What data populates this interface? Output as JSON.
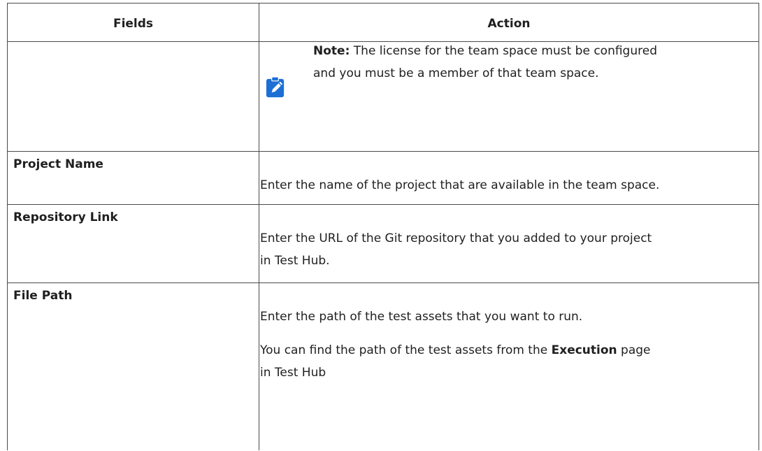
{
  "table": {
    "header": {
      "fields": "Fields",
      "action": "Action"
    },
    "note": {
      "icon": "pencil-note-icon",
      "label": "Note:",
      "text_line1": " The license for the team space must be configured",
      "text_line2": "and you must be a member of that team space."
    },
    "rows": [
      {
        "field": "Project Name",
        "action": "Enter the name of the project that are available in the team space."
      },
      {
        "field": "Repository Link",
        "action_line1": "Enter the URL of the Git repository that you added to your project",
        "action_line2": "in Test Hub."
      },
      {
        "field": "File Path",
        "action": "Enter the path of the test assets that you want to run.",
        "action2_prefix": "You can find the path of the test assets from the ",
        "action2_bold": "Execution",
        "action2_suffix": " page",
        "action2_line2": "in Test Hub"
      }
    ],
    "icon_color": "#1d6fd6"
  }
}
